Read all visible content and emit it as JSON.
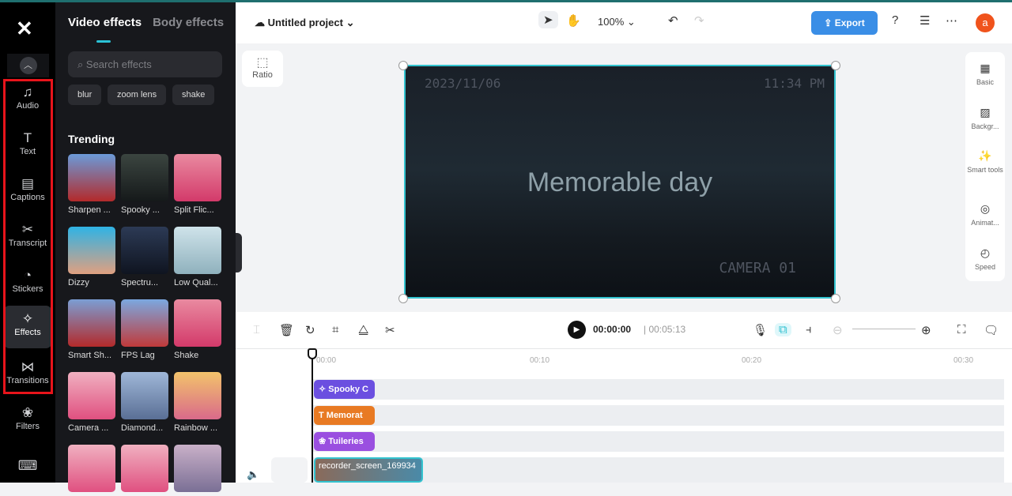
{
  "rail": {
    "items": [
      {
        "label": "Audio",
        "icon": "♫"
      },
      {
        "label": "Text",
        "icon": "T"
      },
      {
        "label": "Captions",
        "icon": "▤"
      },
      {
        "label": "Transcript",
        "icon": "✂"
      },
      {
        "label": "Stickers",
        "icon": "◔"
      },
      {
        "label": "Effects",
        "icon": "✧"
      },
      {
        "label": "Transitions",
        "icon": "⋈"
      },
      {
        "label": "Filters",
        "icon": "❀"
      }
    ]
  },
  "panel": {
    "tabs": [
      "Video effects",
      "Body effects"
    ],
    "search_placeholder": "Search effects",
    "chips": [
      "blur",
      "zoom lens",
      "shake"
    ],
    "section": "Trending",
    "effects": [
      {
        "label": "Sharpen ...",
        "color": "linear-gradient(#6b9ad8,#b32a2a)"
      },
      {
        "label": "Spooky ...",
        "color": "linear-gradient(#3b4540,#15191a)"
      },
      {
        "label": "Split Flic...",
        "color": "linear-gradient(#e98aa0,#d33a6a)"
      },
      {
        "label": "Dizzy",
        "color": "linear-gradient(#2fb3e5,#e0a080)"
      },
      {
        "label": "Spectru...",
        "color": "linear-gradient(#2c3a55,#0f1420)"
      },
      {
        "label": "Low Qual...",
        "color": "linear-gradient(#cfe3ea,#8fb1bd)"
      },
      {
        "label": "Smart Sh...",
        "color": "linear-gradient(#7b9ed4,#b32a2a)"
      },
      {
        "label": "FPS Lag",
        "color": "linear-gradient(#7ba8e0,#c03a3a)"
      },
      {
        "label": "Shake",
        "color": "linear-gradient(#e98aa0,#d33a6a)"
      },
      {
        "label": "Camera ...",
        "color": "linear-gradient(#f0b0c0,#e05080)"
      },
      {
        "label": "Diamond...",
        "color": "linear-gradient(#9fb7d8,#5a6f95)"
      },
      {
        "label": "Rainbow ...",
        "color": "linear-gradient(#f3c36b,#d96a8a)"
      },
      {
        "label": "",
        "color": "linear-gradient(#f0b0c0,#e05080)"
      },
      {
        "label": "",
        "color": "linear-gradient(#f0b0c0,#e05080)"
      },
      {
        "label": "",
        "color": "linear-gradient(#c9b0c8,#7a6f95)"
      }
    ]
  },
  "topbar": {
    "project": "Untitled project",
    "zoom": "100%",
    "export": "Export",
    "avatar": "a"
  },
  "canvas": {
    "ratio": "Ratio",
    "date": "2023/11/06",
    "clock": "11:34 PM",
    "title": "Memorable day",
    "camera": "CAMERA 01"
  },
  "right_panel": [
    {
      "label": "Basic",
      "icon": "▦"
    },
    {
      "label": "Backgr...",
      "icon": "▨"
    },
    {
      "label": "Smart tools",
      "icon": "✨"
    },
    {
      "label": "Animat...",
      "icon": "◎"
    },
    {
      "label": "Speed",
      "icon": "◴"
    }
  ],
  "timeline": {
    "current": "00:00:00",
    "total": "00:05:13",
    "ticks": [
      "00:00",
      "00:10",
      "00:20",
      "00:30"
    ],
    "clips": [
      {
        "label": "✧ Spooky C",
        "color": "#6b4fe0"
      },
      {
        "label": "T Memorat",
        "color": "#e87a23"
      },
      {
        "label": "❀ Tuileries",
        "color": "#9a4fe0"
      },
      {
        "label": "recorder_screen_169934",
        "color": "#4a6a7a"
      }
    ]
  }
}
